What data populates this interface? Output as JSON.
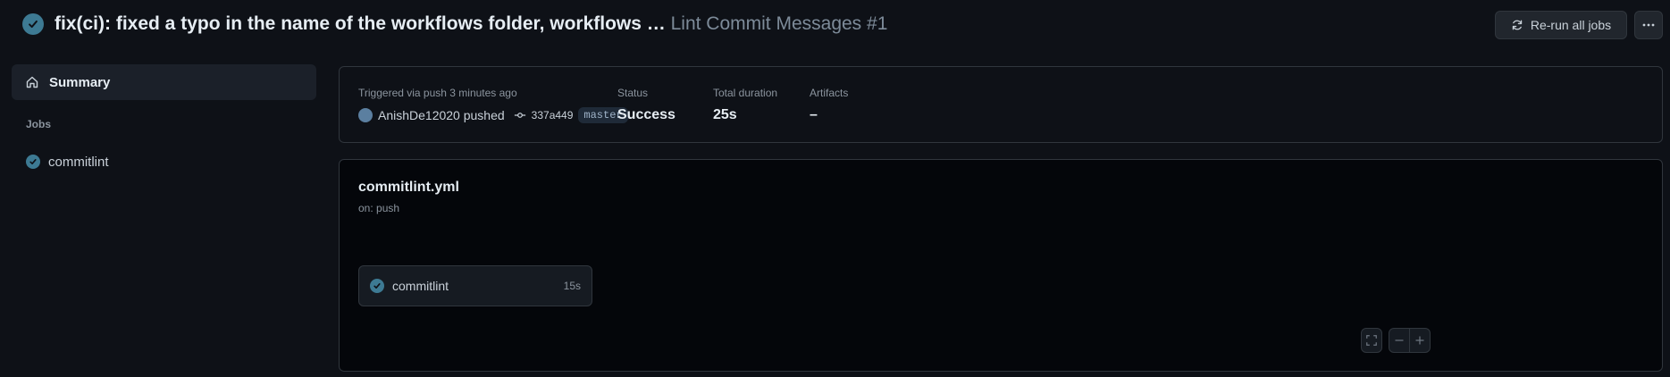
{
  "header": {
    "commit_message": "fix(ci): fixed a typo in the name of the workflows folder, workflows …",
    "workflow_ref": "Lint Commit Messages #1",
    "rerun_label": "Re-run all jobs",
    "status_icon": "check-circle-icon",
    "more_icon": "kebab-horizontal-icon"
  },
  "sidebar": {
    "summary_label": "Summary",
    "jobs_heading": "Jobs",
    "jobs": [
      {
        "label": "commitlint",
        "status": "success"
      }
    ]
  },
  "summary": {
    "trigger_text": "Triggered via push 3 minutes ago",
    "actor": "AnishDe12020 pushed",
    "commit_sha": "337a449",
    "branch": "master",
    "status_label": "Status",
    "status_value": "Success",
    "duration_label": "Total duration",
    "duration_value": "25s",
    "artifacts_label": "Artifacts",
    "artifacts_value": "–"
  },
  "graph": {
    "workflow_file": "commitlint.yml",
    "trigger": "on: push",
    "jobs": [
      {
        "label": "commitlint",
        "duration": "15s",
        "status": "success"
      }
    ]
  },
  "colors": {
    "background": "#0e1117",
    "graph_background": "#04060a",
    "success_badge": "#3d7a93",
    "border": "#30363d"
  }
}
